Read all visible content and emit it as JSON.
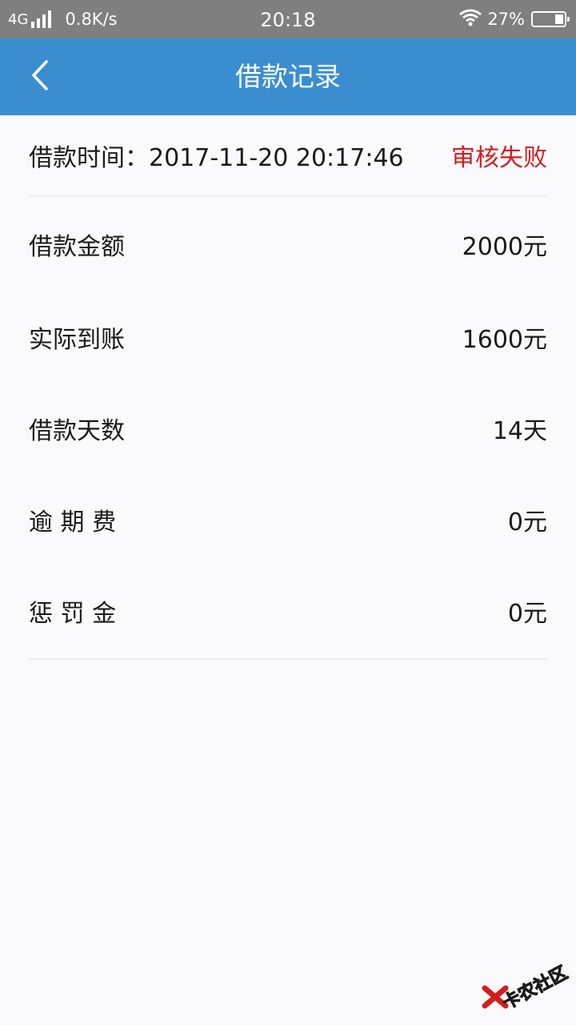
{
  "status_bar": {
    "network": "4G",
    "speed": "0.8K/s",
    "time": "20:18",
    "battery_percent": "27%",
    "battery_level": 0.27
  },
  "header": {
    "title": "借款记录",
    "back_icon": "chevron-left-icon"
  },
  "record": {
    "time_label": "借款时间：",
    "time_value": "2017-11-20 20:17:46",
    "status": "审核失败",
    "status_color": "#d31e1e",
    "rows": [
      {
        "label": "借款金额",
        "value": "2000元"
      },
      {
        "label": "实际到账",
        "value": "1600元"
      },
      {
        "label": "借款天数",
        "value": "14天"
      },
      {
        "label": "逾 期 费",
        "value": "0元"
      },
      {
        "label": "惩 罚 金",
        "value": "0元"
      }
    ]
  },
  "watermark": {
    "text": "卡农社区"
  },
  "colors": {
    "title_bar": "#3a8ed0",
    "status_bar": "#7f7f7f",
    "background": "#fafafc"
  }
}
